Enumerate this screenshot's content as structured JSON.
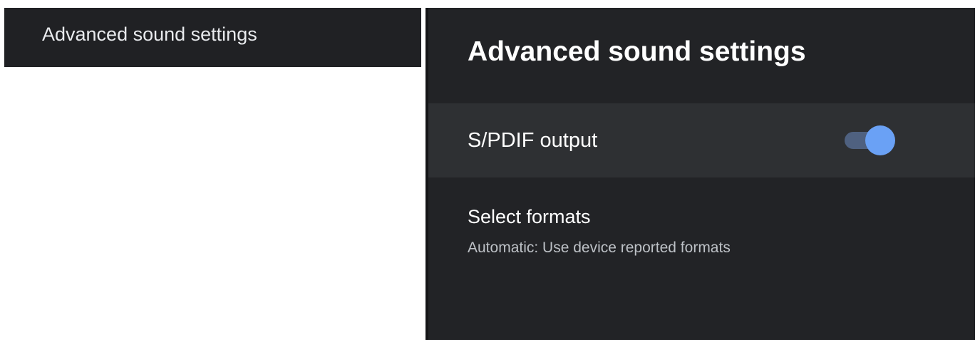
{
  "left_panel": {
    "header_label": "Advanced sound settings"
  },
  "right_panel": {
    "title": "Advanced sound settings",
    "spdif_row": {
      "label": "S/PDIF output",
      "toggle_state": "on"
    },
    "formats_row": {
      "title": "Select formats",
      "subtitle": "Automatic: Use device reported formats"
    }
  },
  "colors": {
    "panel_background": "#222326",
    "focused_row_background": "#2e3033",
    "toggle_thumb": "#6aa1f5",
    "toggle_track": "#4f6180",
    "left_header_background": "#202124"
  }
}
